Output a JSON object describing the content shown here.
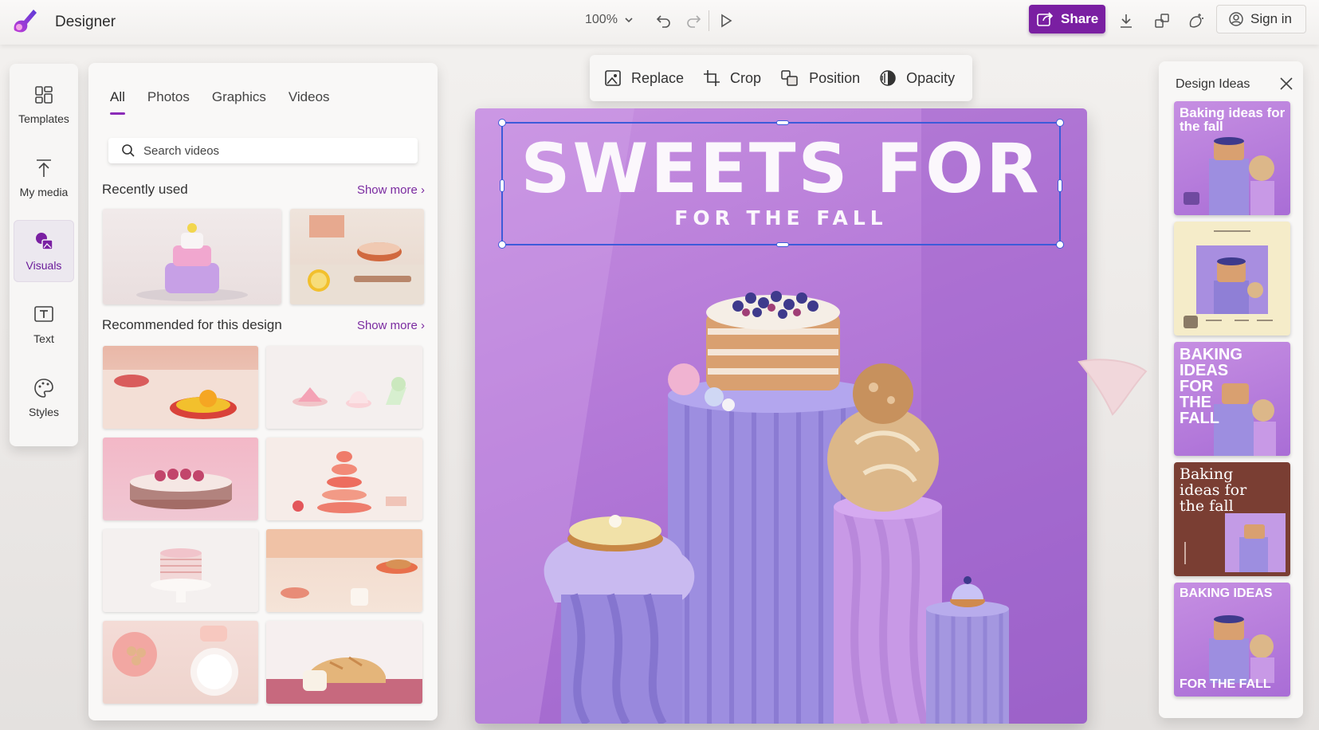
{
  "app": {
    "title": "Designer"
  },
  "toolbar": {
    "zoom": "100%",
    "share_label": "Share",
    "signin_label": "Sign in",
    "icons": [
      "undo-icon",
      "redo-icon",
      "play-icon",
      "download-icon",
      "resize-icon",
      "magic-icon",
      "account-icon"
    ]
  },
  "rail": {
    "items": [
      {
        "label": "Templates",
        "icon": "templates-icon"
      },
      {
        "label": "My media",
        "icon": "upload-icon"
      },
      {
        "label": "Visuals",
        "icon": "visuals-icon",
        "active": true
      },
      {
        "label": "Text",
        "icon": "text-icon"
      },
      {
        "label": "Styles",
        "icon": "palette-icon"
      }
    ]
  },
  "panel": {
    "tabs": [
      {
        "label": "All",
        "active": true
      },
      {
        "label": "Photos"
      },
      {
        "label": "Graphics"
      },
      {
        "label": "Videos"
      }
    ],
    "search_placeholder": "Search videos",
    "recent_title": "Recently used",
    "recommended_title": "Recommended for this design",
    "show_more": "Show more"
  },
  "context_toolbar": {
    "items": [
      {
        "label": "Replace",
        "icon": "image-replace-icon"
      },
      {
        "label": "Crop",
        "icon": "crop-icon"
      },
      {
        "label": "Position",
        "icon": "position-icon"
      },
      {
        "label": "Opacity",
        "icon": "opacity-icon"
      }
    ]
  },
  "canvas": {
    "title": "SWEETS FOR",
    "subtitle": "FOR THE FALL"
  },
  "design_ideas": {
    "title": "Design Ideas",
    "cards": [
      {
        "text": "Baking ideas for the fall"
      },
      {
        "text": ""
      },
      {
        "text": "BAKING IDEAS FOR THE FALL"
      },
      {
        "text": "Baking ideas for the fall"
      },
      {
        "text_top": "BAKING IDEAS",
        "text_bottom": "FOR THE FALL"
      }
    ]
  },
  "colors": {
    "accent": "#7a1fa2",
    "canvas_purple": "#b57ad8",
    "selection": "#3d5bd9"
  }
}
